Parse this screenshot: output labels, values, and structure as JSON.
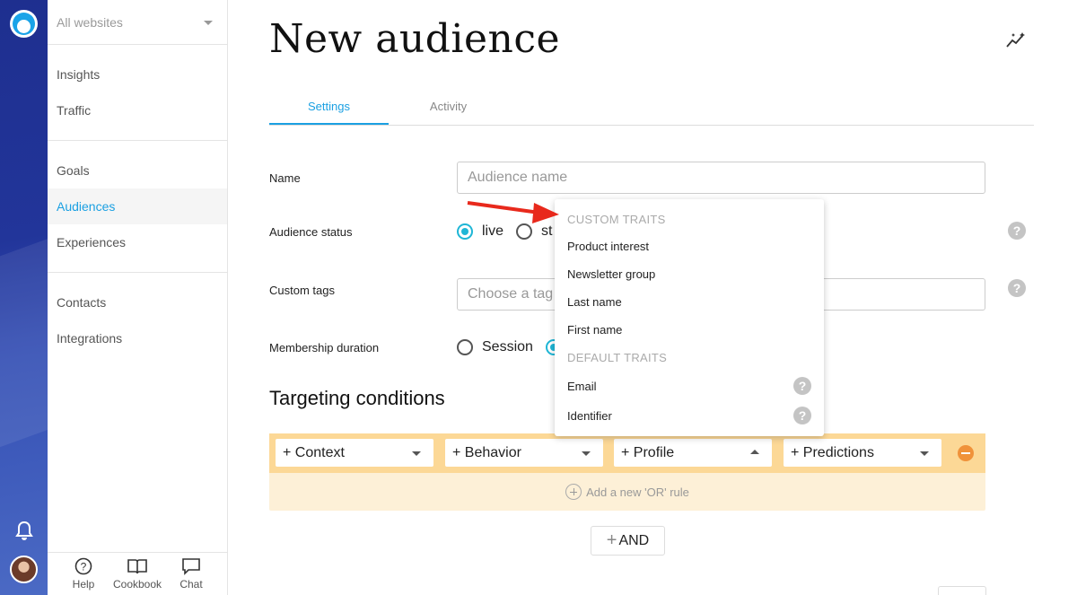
{
  "sidebar": {
    "site_select": "All websites",
    "groups": [
      [
        "Insights",
        "Traffic"
      ],
      [
        "Goals",
        "Audiences",
        "Experiences"
      ],
      [
        "Contacts",
        "Integrations"
      ]
    ],
    "footer": {
      "help": "Help",
      "cookbook": "Cookbook",
      "chat": "Chat"
    }
  },
  "page": {
    "title": "New audience"
  },
  "tabs": {
    "settings": "Settings",
    "activity": "Activity"
  },
  "form": {
    "name_label": "Name",
    "name_placeholder": "Audience name",
    "status_label": "Audience status",
    "status_live": "live",
    "status_stopped_partial": "st",
    "tags_label": "Custom tags",
    "tags_placeholder_partial": "Choose a tag o",
    "duration_label": "Membership duration",
    "duration_session": "Session",
    "help_glyph": "?"
  },
  "targeting": {
    "title": "Targeting conditions",
    "selects": [
      "+ Context",
      "+ Behavior",
      "+ Profile",
      "+ Predictions"
    ],
    "or_rule": "Add a new 'OR' rule",
    "and_button": "AND"
  },
  "dropdown": {
    "custom_header": "CUSTOM TRAITS",
    "custom_items": [
      "Product interest",
      "Newsletter group",
      "Last name",
      "First name"
    ],
    "default_header": "DEFAULT TRAITS",
    "default_items": [
      "Email",
      "Identifier"
    ]
  },
  "colors": {
    "accent": "#1ba0e2",
    "radio": "#1fb6d6",
    "condition_bar": "#fcd896",
    "condition_bg": "#fdf0d7",
    "arrow": "#e8291c"
  }
}
